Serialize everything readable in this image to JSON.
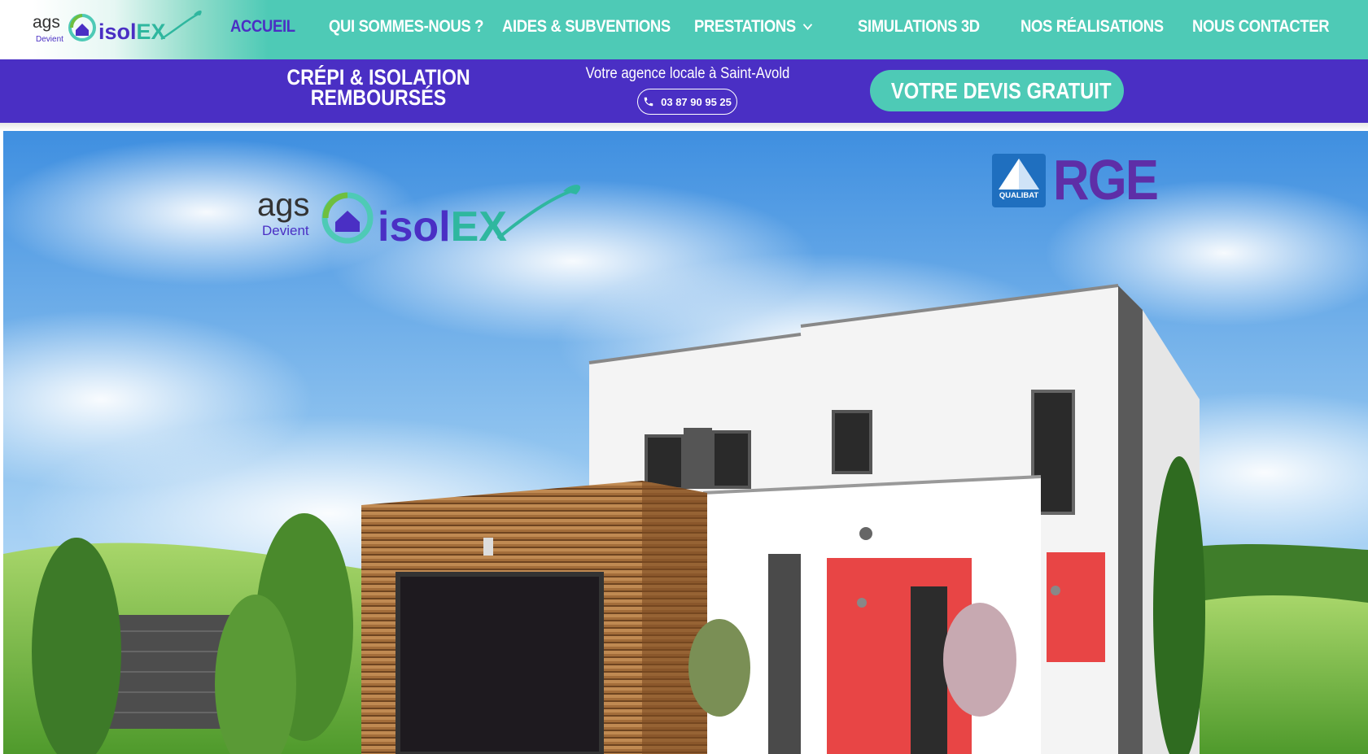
{
  "brand": {
    "prefix": "ags",
    "devient": "Devient",
    "name_part1": "isol",
    "name_part2": "EX",
    "colors": {
      "purple": "#4a2fc4",
      "teal": "#4ecab6",
      "rge_purple": "#5e2ea7",
      "qualibat_blue": "#1f6fbf"
    }
  },
  "nav": {
    "items": [
      {
        "label": "ACCUEIL",
        "active": true
      },
      {
        "label": "QUI SOMMES-NOUS ?"
      },
      {
        "label": "AIDES & SUBVENTIONS"
      },
      {
        "label": "PRESTATIONS",
        "has_dropdown": true,
        "icon": "chevron-down-icon"
      },
      {
        "label": "SIMULATIONS 3D"
      },
      {
        "label": "NOS RÉALISATIONS"
      },
      {
        "label": "NOUS CONTACTER"
      }
    ]
  },
  "infobar": {
    "tagline_line1": "CRÉPI & ISOLATION",
    "tagline_line2": "REMBOURSÉS",
    "agency_text": "Votre agence locale à Saint-Avold",
    "phone": "03 87 90 95 25",
    "phone_icon": "phone-icon",
    "cta_label": "VOTRE DEVIS GRATUIT",
    "cta_icon": "pointing-hand-icon"
  },
  "hero": {
    "badge_qualibat": "QUALIBAT",
    "badge_rge": "RGE"
  }
}
